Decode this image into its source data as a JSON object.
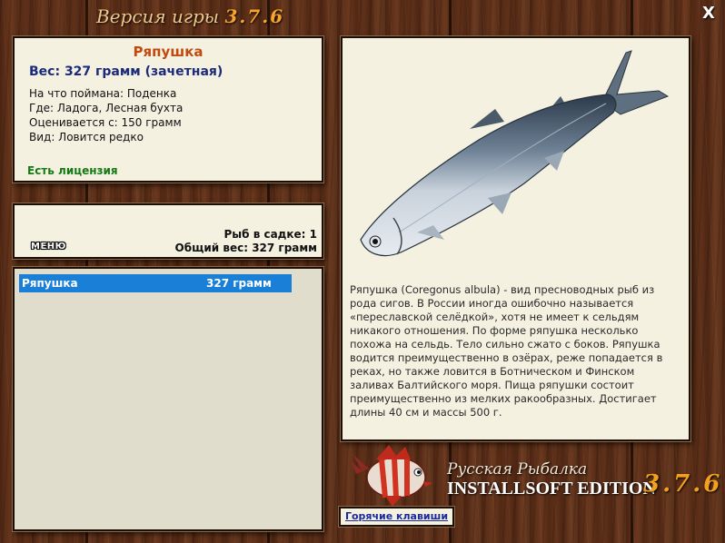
{
  "window": {
    "title_prefix": "Версия игры",
    "title_version": "3.7.6",
    "close_label": "X"
  },
  "fish_info": {
    "name": "Ряпушка",
    "weight": "Вес: 327 грамм (зачетная)",
    "bait": "На что поймана: Поденка",
    "location": "Где: Ладога, Лесная бухта",
    "rated_from": "Оценивается с: 150 грамм",
    "type": "Вид: Ловится редко",
    "license": "Есть лицензия"
  },
  "keepnet": {
    "menu_label": "МЕНЮ",
    "count": "Рыб в садке: 1",
    "total_weight": "Общий вес: 327 грамм"
  },
  "catch_list": [
    {
      "name": "Ряпушка",
      "weight": "327 грамм"
    }
  ],
  "description": "Ряпушка (Coregonus albula) - вид пресноводных рыб из рода сигов. В России иногда ошибочно называется «переславской селёдкой», хотя не имеет к сельдям никакого отношения. По форме ряпушка несколько похожа на сельдь. Тело сильно сжато с боков. Ряпушка водится преимущественно в озёрах, реже попадается в реках, но также ловится в Ботническом и Финском заливах Балтийского моря. Пища ряпушки состоит преимущественно из мелких ракообразных. Достигает длины 40 см и массы 500 г.",
  "logo": {
    "line1": "Русская Рыбалка",
    "line2": "INSTALLSOFT EDITION",
    "version": "3.7.6"
  },
  "hotkeys_label": "Горячие клавиши"
}
